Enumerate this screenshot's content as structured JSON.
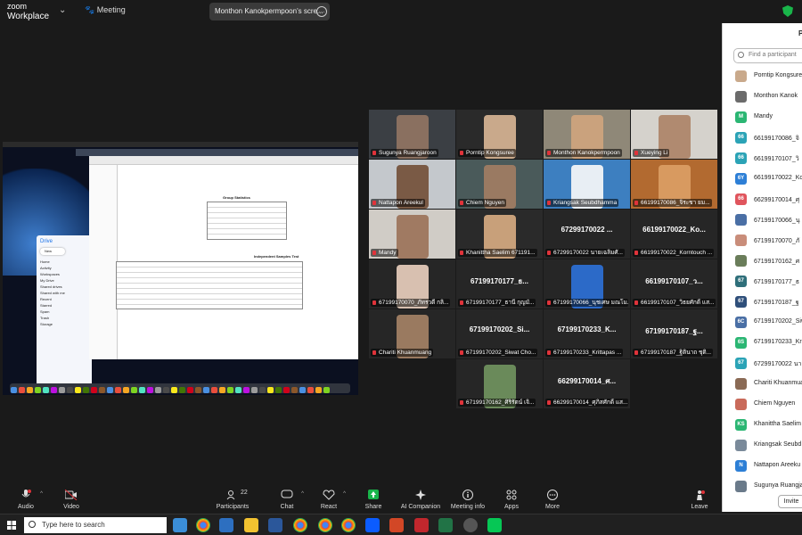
{
  "app": {
    "brand_line1": "zoom",
    "brand_line2": "Workplace",
    "meeting_tab": "Meeting",
    "share_tab": "Monthon Kanokpermpoon's scre..."
  },
  "panel": {
    "title": "P",
    "search_placeholder": "Find a participant",
    "invite": "Invite",
    "participants": [
      {
        "avatar": "",
        "color": "#c9a98b",
        "name": "Porntip Kongsure"
      },
      {
        "avatar": "",
        "color": "#6b6b6b",
        "name": "Monthon Kanok"
      },
      {
        "avatar": "M",
        "color": "#2bb673",
        "name": "Mandy"
      },
      {
        "avatar": "66",
        "color": "#2ba3b6",
        "name": "66199170086_จิ"
      },
      {
        "avatar": "66",
        "color": "#2ba3b6",
        "name": "66199170107_วิ"
      },
      {
        "avatar": "6Y",
        "color": "#2d7fd6",
        "name": "66199170022_Kor"
      },
      {
        "avatar": "66",
        "color": "#e0555d",
        "name": "66299170014_ศุ"
      },
      {
        "avatar": "",
        "color": "#4a6fa5",
        "name": "67199170066_นุ"
      },
      {
        "avatar": "",
        "color": "#c98d7a",
        "name": "67199170070_ภั"
      },
      {
        "avatar": "",
        "color": "#6a7d5a",
        "name": "67199170162_ศ"
      },
      {
        "avatar": "67",
        "color": "#2f6f7a",
        "name": "67199170177_ธ"
      },
      {
        "avatar": "67",
        "color": "#2f4f7a",
        "name": "67199170187_ฐ"
      },
      {
        "avatar": "6C",
        "color": "#4a6fa5",
        "name": "67199170202_Siw"
      },
      {
        "avatar": "6S",
        "color": "#2bb673",
        "name": "67199170233_Kri"
      },
      {
        "avatar": "67",
        "color": "#2ba3b6",
        "name": "67299170022 นา"
      },
      {
        "avatar": "",
        "color": "#8a6a55",
        "name": "Chariti Khuanmua"
      },
      {
        "avatar": "",
        "color": "#c96a5a",
        "name": "Chiem Nguyen"
      },
      {
        "avatar": "KS",
        "color": "#2bb673",
        "name": "Khanittha Saelim"
      },
      {
        "avatar": "",
        "color": "#7a8a9a",
        "name": "Kriangsak Seubd"
      },
      {
        "avatar": "N",
        "color": "#2d7fd6",
        "name": "Nattapon Areeku"
      },
      {
        "avatar": "",
        "color": "#6a7a8a",
        "name": "Sugunya Ruangja"
      }
    ]
  },
  "gallery": {
    "tiles": [
      {
        "label": "Sugunya Ruangjaroon",
        "big": "",
        "bg": "#3b3f44",
        "face": "#8a7060",
        "active": false
      },
      {
        "label": "Porntip Kongsuree",
        "big": "",
        "bg": "#2a2a2a",
        "face": "#c9a98b",
        "active": false
      },
      {
        "label": "Monthon Kanokpermpoon",
        "big": "",
        "bg": "#8f8878",
        "face": "#caa27d",
        "active": true
      },
      {
        "label": "Xueying Li",
        "big": "",
        "bg": "#d5d2cc",
        "face": "#b08a70",
        "active": false
      },
      {
        "label": "Nattapon Areekul",
        "big": "",
        "bg": "#c4c8cc",
        "face": "#7a5a45",
        "active": false
      },
      {
        "label": "Chiem Nguyen",
        "big": "",
        "bg": "#4a5a5a",
        "face": "#9a7a62",
        "active": false
      },
      {
        "label": "Kriangsak Seubdhamma",
        "big": "",
        "bg": "#3d7fc0",
        "face": "#e8eef4",
        "active": false
      },
      {
        "label": "66199170086_จิระชา ยม...",
        "big": "",
        "bg": "#b26a30",
        "face": "#d89a60",
        "active": false
      },
      {
        "label": "Mandy",
        "big": "",
        "bg": "#d0ccc6",
        "face": "#a07a62",
        "active": false
      },
      {
        "label": "Khanittha Saelim 671191...",
        "big": "",
        "bg": "#2a2a2a",
        "face": "#c8a07a",
        "active": false
      },
      {
        "label": "67299170022 นายเฉลิมศั...",
        "big": "67299170022 ...",
        "bg": "#262626",
        "face": "",
        "active": false
      },
      {
        "label": "66199170022_Korntouch ...",
        "big": "66199170022_Ko...",
        "bg": "#262626",
        "face": "",
        "active": false
      },
      {
        "label": "67199170070_ภัทรวดี กลิ...",
        "big": "",
        "bg": "#262626",
        "face": "#d8c0b0",
        "active": false
      },
      {
        "label": "67199170177_ธานี กุญมั...",
        "big": "67199170177_ธ...",
        "bg": "#262626",
        "face": "",
        "active": false
      },
      {
        "label": "67199170066_นุชเศษ มณโม...",
        "big": "",
        "bg": "#262626",
        "face": "#2c6ac8",
        "active": false
      },
      {
        "label": "66199170107_วิธยศักดิ์ แส...",
        "big": "66199170107_ว...",
        "bg": "#262626",
        "face": "",
        "active": false
      },
      {
        "label": "Chariti Khuanmuang",
        "big": "",
        "bg": "#262626",
        "face": "#9a7a60",
        "active": false
      },
      {
        "label": "67199170202_Siwat Cho...",
        "big": "67199170202_Si...",
        "bg": "#262626",
        "face": "",
        "active": false
      },
      {
        "label": "67199170233_Krittapas ...",
        "big": "67199170233_K...",
        "bg": "#262626",
        "face": "",
        "active": false
      },
      {
        "label": "67199170187_ฐิตินาถ ชุติ...",
        "big": "67199170187_ฐ...",
        "bg": "#262626",
        "face": "",
        "active": false
      },
      {
        "label": "67199170162_ศิริรัตน์ เจิ...",
        "big": "",
        "bg": "#262626",
        "face": "#6a8a5a",
        "active": false
      },
      {
        "label": "66299170014_ศุภิสศักดิ์ แส...",
        "big": "66299170014_ศ...",
        "bg": "#262626",
        "face": "",
        "active": false
      }
    ]
  },
  "shared_screen": {
    "drive_title": "Drive",
    "drive_new": "New",
    "drive_items": [
      "Home",
      "Activity",
      "Workspaces",
      "My Drive",
      "Shared drives",
      "Shared with me",
      "Recent",
      "Starred",
      "Spam",
      "Trash",
      "Storage"
    ],
    "table1_title": "Group Statistics",
    "table2_title": "Independent Samples Test"
  },
  "toolbar": {
    "audio": "Audio",
    "video": "Video",
    "participants": "Participants",
    "participants_count": "22",
    "chat": "Chat",
    "react": "React",
    "share": "Share",
    "ai": "AI Companion",
    "info": "Meeting info",
    "apps": "Apps",
    "more": "More",
    "leave": "Leave"
  },
  "taskbar": {
    "search_placeholder": "Type here to search"
  },
  "colors": {
    "accent_green": "#2bd659",
    "share_green": "#19b54a",
    "leave_red": "#e0333a"
  }
}
